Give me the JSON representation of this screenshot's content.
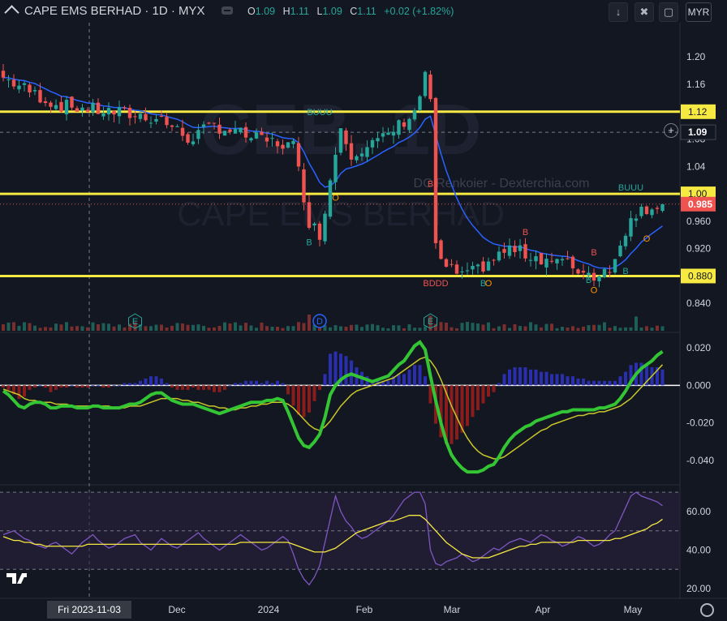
{
  "header": {
    "title": "CAPE EMS BERHAD · 1D · MYX",
    "ohlc": [
      {
        "k": "O",
        "v": "1.09"
      },
      {
        "k": "H",
        "v": "1.11"
      },
      {
        "k": "L",
        "v": "1.09"
      },
      {
        "k": "C",
        "v": "1.11"
      },
      {
        "k": "",
        "v": "+0.02 (+1.82%)"
      }
    ],
    "currency": "MYR"
  },
  "watermark": {
    "symbol": "CEB, 1D",
    "name": "CAPE EMS BERHAD",
    "credit": "DC Renkoier - Dexterchia.com"
  },
  "colors": {
    "bg": "#131722",
    "up": "#26a69a",
    "down": "#ef5350",
    "level": "#f5e942",
    "ema": "#2962ff",
    "macd": "#33c533",
    "signal": "#c8c828",
    "rsi": "#7e57c2",
    "rsi_ma": "#f5e942"
  },
  "chart_data": [
    {
      "type": "candlestick",
      "x_labels": [
        "Dec",
        "2024",
        "Feb",
        "Mar",
        "Apr",
        "May"
      ],
      "crosshair_date": "Fri 2023-11-03",
      "y_ticks": [
        "1.20",
        "1.16",
        "1.08",
        "1.04",
        "0.960",
        "0.920",
        "0.840"
      ],
      "ylim": [
        0.8,
        1.25
      ],
      "levels": [
        {
          "label": "1.12",
          "value": 1.12
        },
        {
          "label": "1.00",
          "value": 1.0
        },
        {
          "label": "0.880",
          "value": 0.88
        }
      ],
      "price_labels": [
        {
          "label": "1.09",
          "value": 1.09
        },
        {
          "label": "0.985",
          "value": 0.985
        }
      ],
      "signals": [
        {
          "text": "BUUU",
          "i": 60,
          "value": 1.115,
          "color": "#26a69a"
        },
        {
          "text": "B",
          "i": 58,
          "value": 0.925,
          "color": "#26a69a"
        },
        {
          "text": "O",
          "i": 63,
          "value": 0.99,
          "color": "#ff9800"
        },
        {
          "text": "B",
          "i": 81,
          "value": 1.01,
          "color": "#ef5350"
        },
        {
          "text": "BDDD",
          "i": 82,
          "value": 0.865,
          "color": "#ef5350"
        },
        {
          "text": "B",
          "i": 99,
          "value": 0.94,
          "color": "#ef5350"
        },
        {
          "text": "O",
          "i": 92,
          "value": 0.865,
          "color": "#ff9800"
        },
        {
          "text": "B",
          "i": 91,
          "value": 0.865,
          "color": "#26a69a"
        },
        {
          "text": "B",
          "i": 112,
          "value": 0.91,
          "color": "#ef5350"
        },
        {
          "text": "B",
          "i": 111,
          "value": 0.87,
          "color": "#26a69a"
        },
        {
          "text": "O",
          "i": 112,
          "value": 0.855,
          "color": "#ff9800"
        },
        {
          "text": "B",
          "i": 118,
          "value": 0.883,
          "color": "#26a69a"
        },
        {
          "text": "BUUU",
          "i": 119,
          "value": 1.005,
          "color": "#26a69a"
        },
        {
          "text": "O",
          "i": 122,
          "value": 0.93,
          "color": "#ff9800"
        }
      ],
      "events": [
        {
          "text": "E",
          "i": 25
        },
        {
          "text": "D",
          "i": 60
        },
        {
          "text": "E",
          "i": 81
        }
      ],
      "candles": {
        "count": 126,
        "last_close": 0.985
      }
    },
    {
      "type": "line",
      "name": "",
      "y_ticks": [
        "0.020",
        "0.000",
        "-0.020",
        "-0.040"
      ],
      "ylim": [
        -0.052,
        0.026
      ],
      "series_macd": [
        -0.003,
        -0.005,
        -0.008,
        -0.011,
        -0.012,
        -0.01,
        -0.009,
        -0.009,
        -0.01,
        -0.012,
        -0.012,
        -0.011,
        -0.011,
        -0.011,
        -0.012,
        -0.012,
        -0.012,
        -0.011,
        -0.011,
        -0.012,
        -0.012,
        -0.012,
        -0.012,
        -0.011,
        -0.01,
        -0.01,
        -0.009,
        -0.007,
        -0.005,
        -0.004,
        -0.004,
        -0.006,
        -0.008,
        -0.009,
        -0.01,
        -0.01,
        -0.01,
        -0.011,
        -0.012,
        -0.013,
        -0.014,
        -0.015,
        -0.014,
        -0.013,
        -0.012,
        -0.011,
        -0.01,
        -0.009,
        -0.009,
        -0.009,
        -0.008,
        -0.008,
        -0.007,
        -0.008,
        -0.014,
        -0.021,
        -0.028,
        -0.032,
        -0.033,
        -0.03,
        -0.026,
        -0.017,
        -0.005,
        0.0,
        0.003,
        0.005,
        0.006,
        0.005,
        0.004,
        0.003,
        0.002,
        0.003,
        0.004,
        0.005,
        0.008,
        0.011,
        0.013,
        0.017,
        0.021,
        0.023,
        0.019,
        0.005,
        -0.008,
        -0.02,
        -0.03,
        -0.037,
        -0.041,
        -0.044,
        -0.046,
        -0.046,
        -0.046,
        -0.045,
        -0.043,
        -0.042,
        -0.038,
        -0.033,
        -0.029,
        -0.026,
        -0.024,
        -0.022,
        -0.021,
        -0.019,
        -0.018,
        -0.017,
        -0.016,
        -0.015,
        -0.014,
        -0.014,
        -0.013,
        -0.013,
        -0.013,
        -0.013,
        -0.013,
        -0.012,
        -0.012,
        -0.011,
        -0.01,
        -0.007,
        -0.003,
        0.002,
        0.006,
        0.009,
        0.011,
        0.013,
        0.016,
        0.018
      ],
      "series_signal": [
        -0.002,
        -0.003,
        -0.004,
        -0.005,
        -0.007,
        -0.008,
        -0.008,
        -0.009,
        -0.009,
        -0.009,
        -0.01,
        -0.01,
        -0.01,
        -0.011,
        -0.011,
        -0.011,
        -0.011,
        -0.011,
        -0.011,
        -0.011,
        -0.011,
        -0.012,
        -0.012,
        -0.012,
        -0.011,
        -0.011,
        -0.011,
        -0.01,
        -0.009,
        -0.008,
        -0.007,
        -0.007,
        -0.007,
        -0.007,
        -0.008,
        -0.008,
        -0.009,
        -0.009,
        -0.01,
        -0.011,
        -0.011,
        -0.012,
        -0.012,
        -0.013,
        -0.013,
        -0.012,
        -0.012,
        -0.011,
        -0.011,
        -0.01,
        -0.01,
        -0.009,
        -0.009,
        -0.009,
        -0.01,
        -0.012,
        -0.015,
        -0.018,
        -0.021,
        -0.023,
        -0.024,
        -0.022,
        -0.019,
        -0.015,
        -0.011,
        -0.008,
        -0.005,
        -0.003,
        -0.002,
        -0.001,
        0.0,
        0.001,
        0.002,
        0.003,
        0.004,
        0.006,
        0.008,
        0.01,
        0.012,
        0.014,
        0.015,
        0.013,
        0.009,
        0.003,
        -0.004,
        -0.011,
        -0.017,
        -0.023,
        -0.028,
        -0.032,
        -0.035,
        -0.037,
        -0.038,
        -0.039,
        -0.039,
        -0.038,
        -0.036,
        -0.034,
        -0.032,
        -0.03,
        -0.028,
        -0.026,
        -0.024,
        -0.023,
        -0.021,
        -0.02,
        -0.019,
        -0.018,
        -0.017,
        -0.016,
        -0.016,
        -0.015,
        -0.015,
        -0.014,
        -0.014,
        -0.013,
        -0.012,
        -0.011,
        -0.009,
        -0.007,
        -0.004,
        -0.001,
        0.002,
        0.005,
        0.008,
        0.011
      ]
    },
    {
      "type": "line",
      "name": "",
      "y_ticks": [
        "60.00",
        "40.00",
        "20.00"
      ],
      "ylim": [
        15,
        73
      ],
      "bands": [
        70,
        50,
        30
      ],
      "series_rsi": [
        48,
        49,
        50,
        48,
        46,
        45,
        43,
        42,
        41,
        43,
        44,
        42,
        40,
        38,
        41,
        44,
        46,
        48,
        45,
        43,
        41,
        42,
        44,
        46,
        47,
        48,
        44,
        42,
        40,
        43,
        46,
        44,
        42,
        41,
        43,
        45,
        47,
        49,
        46,
        44,
        42,
        40,
        42,
        44,
        46,
        48,
        46,
        44,
        42,
        40,
        41,
        43,
        45,
        47,
        45,
        38,
        30,
        25,
        22,
        26,
        32,
        44,
        56,
        68,
        60,
        55,
        52,
        48,
        46,
        47,
        49,
        51,
        53,
        55,
        58,
        62,
        66,
        68,
        70,
        70,
        64,
        40,
        33,
        32,
        34,
        35,
        36,
        38,
        36,
        34,
        35,
        37,
        39,
        41,
        40,
        42,
        44,
        45,
        46,
        45,
        44,
        46,
        48,
        47,
        45,
        44,
        42,
        43,
        45,
        47,
        46,
        44,
        42,
        43,
        45,
        48,
        50,
        56,
        62,
        68,
        70,
        68,
        67,
        66,
        65,
        63
      ],
      "series_ma": [
        47,
        46,
        45,
        45,
        44,
        44,
        43,
        43,
        42,
        42,
        42,
        42,
        42,
        42,
        42,
        42,
        43,
        43,
        43,
        43,
        43,
        43,
        43,
        43,
        43,
        43,
        43,
        43,
        43,
        43,
        43,
        43,
        43,
        43,
        43,
        43,
        43,
        43,
        43,
        43,
        43,
        43,
        43,
        43,
        43,
        44,
        44,
        44,
        44,
        44,
        44,
        44,
        44,
        44,
        44,
        43,
        42,
        41,
        40,
        39,
        39,
        39,
        40,
        41,
        43,
        45,
        47,
        49,
        50,
        51,
        52,
        53,
        54,
        55,
        55,
        56,
        57,
        58,
        58,
        58,
        56,
        53,
        50,
        47,
        44,
        42,
        40,
        38,
        37,
        36,
        36,
        36,
        36,
        37,
        38,
        39,
        40,
        41,
        42,
        42,
        43,
        43,
        44,
        44,
        44,
        44,
        44,
        44,
        44,
        45,
        45,
        45,
        45,
        45,
        45,
        45,
        46,
        46,
        47,
        48,
        49,
        50,
        51,
        53,
        54,
        56
      ]
    }
  ]
}
